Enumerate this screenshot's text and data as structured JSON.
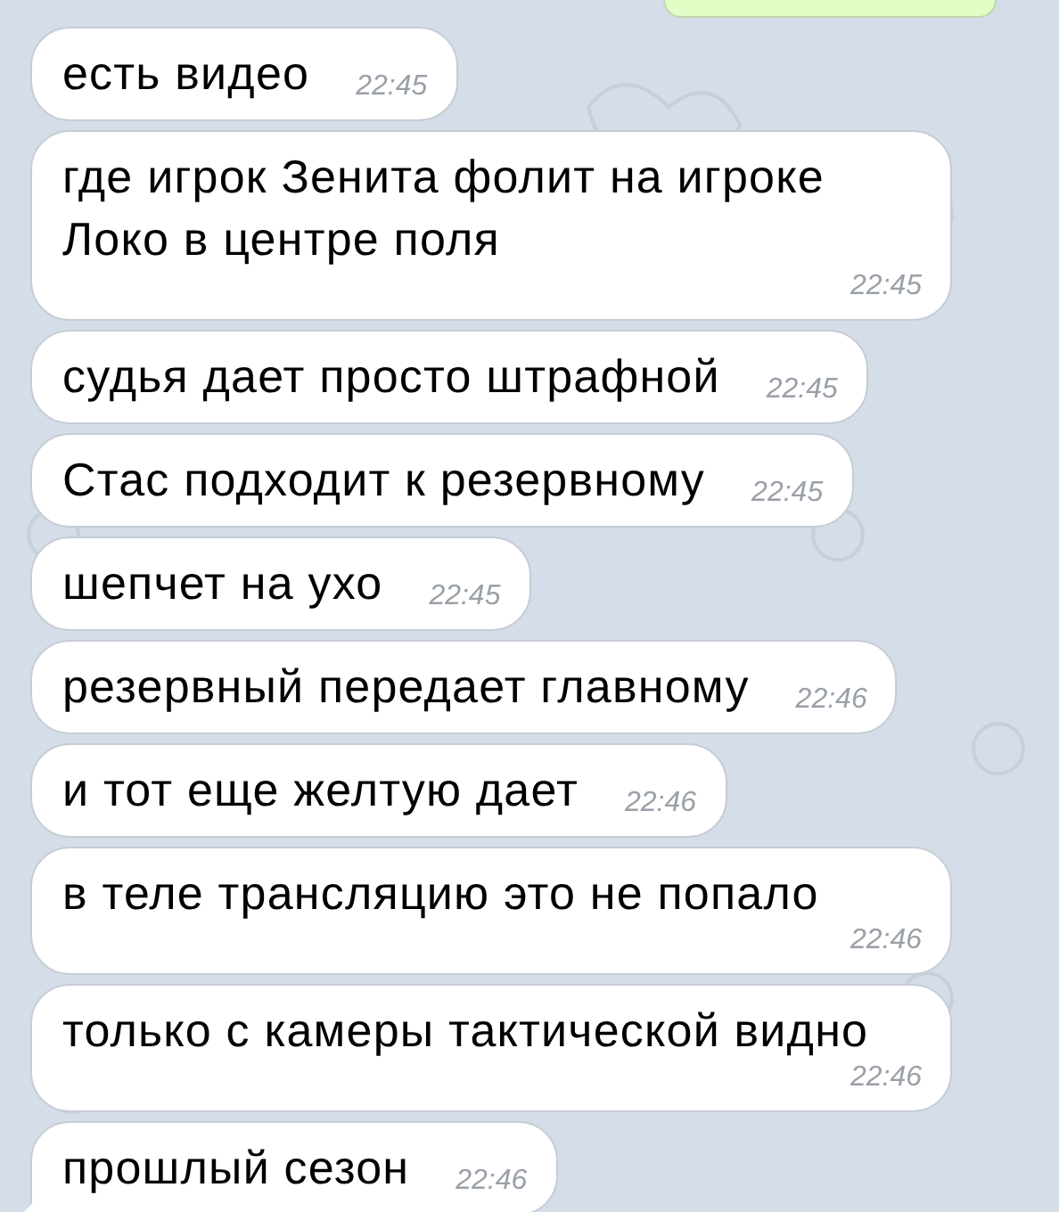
{
  "outgoing_partial": {
    "kind": "outgoing"
  },
  "messages": [
    {
      "text": "есть видео",
      "time": "22:45",
      "tail": false
    },
    {
      "text": "где игрок Зенита фолит на игроке Локо в центре поля",
      "time": "22:45",
      "tail": false
    },
    {
      "text": "судья дает просто штрафной",
      "time": "22:45",
      "tail": false
    },
    {
      "text": "Стас подходит к резервному",
      "time": "22:45",
      "tail": false
    },
    {
      "text": "шепчет на ухо",
      "time": "22:45",
      "tail": false
    },
    {
      "text": "резервный передает главному",
      "time": "22:46",
      "tail": false
    },
    {
      "text": "и тот еще желтую дает",
      "time": "22:46",
      "tail": false
    },
    {
      "text": "в теле трансляцию это не попало",
      "time": "22:46",
      "tail": false
    },
    {
      "text": "только с камеры тактической видно",
      "time": "22:46",
      "tail": false
    },
    {
      "text": "прошлый сезон",
      "time": "22:46",
      "tail": true
    }
  ]
}
